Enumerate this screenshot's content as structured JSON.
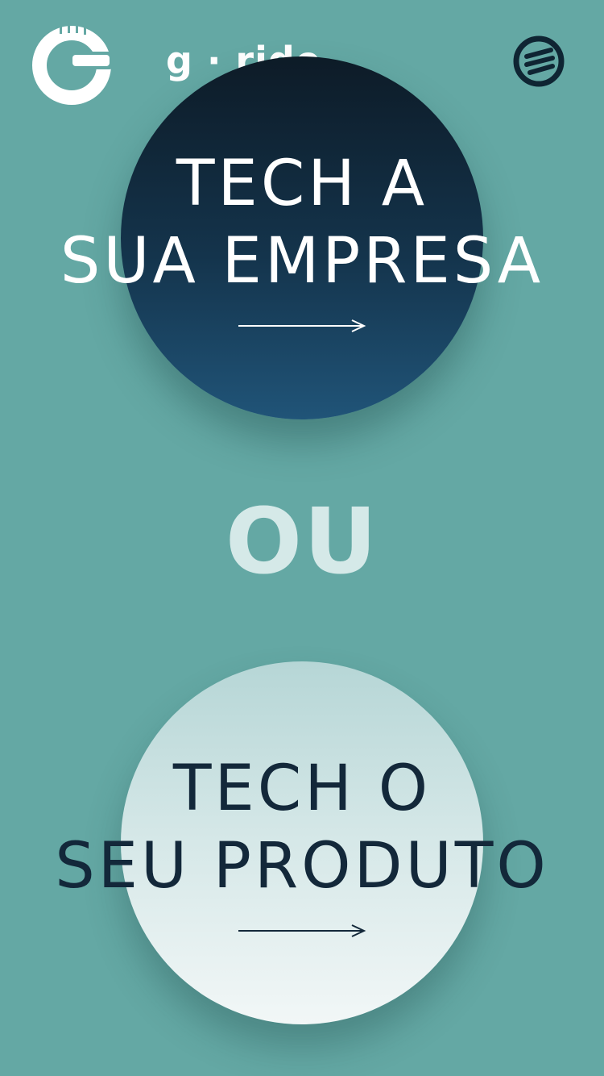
{
  "header": {
    "logo_name": "g-ride-logo-icon",
    "brand_name": "g · ride",
    "menu_icon": "g-ride-menu-icon"
  },
  "options": [
    {
      "line1": "TECH A",
      "line2": "SUA EMPRESA",
      "arrow_icon": "arrow-right-icon",
      "circle_gradient": [
        "#0d1b27",
        "#205478"
      ],
      "text_color": "#ffffff"
    },
    {
      "line1": "TECH O",
      "line2": "SEU PRODUTO",
      "arrow_icon": "arrow-right-icon",
      "circle_gradient": [
        "#b6d6d6",
        "#f2f7f7"
      ],
      "text_color": "#13283a"
    }
  ],
  "divider": {
    "text": "OU"
  },
  "colors": {
    "background": "#64a8a4",
    "divider_text": "#d5e9e8"
  }
}
